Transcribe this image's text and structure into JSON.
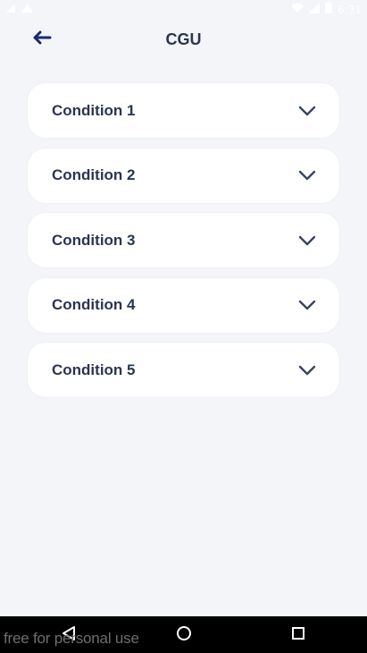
{
  "status_bar": {
    "time": "6:31",
    "icons": [
      "sim-icon",
      "warning-icon",
      "wifi-icon",
      "signal-icon",
      "battery-icon"
    ]
  },
  "header": {
    "back_icon": "arrow-left-icon",
    "title": "CGU"
  },
  "accordion": {
    "items": [
      {
        "label": "Condition 1",
        "icon": "chevron-down-icon"
      },
      {
        "label": "Condition 2",
        "icon": "chevron-down-icon"
      },
      {
        "label": "Condition 3",
        "icon": "chevron-down-icon"
      },
      {
        "label": "Condition 4",
        "icon": "chevron-down-icon"
      },
      {
        "label": "Condition 5",
        "icon": "chevron-down-icon"
      }
    ]
  },
  "nav_bar": {
    "icons": [
      "back-triangle-icon",
      "home-circle-icon",
      "recents-square-icon"
    ],
    "watermark": "free for personal use"
  },
  "colors": {
    "background": "#f4f5f9",
    "card": "#ffffff",
    "text_primary": "#2b3552",
    "back_arrow": "#1d2a6b",
    "chevron": "#3a4460"
  }
}
